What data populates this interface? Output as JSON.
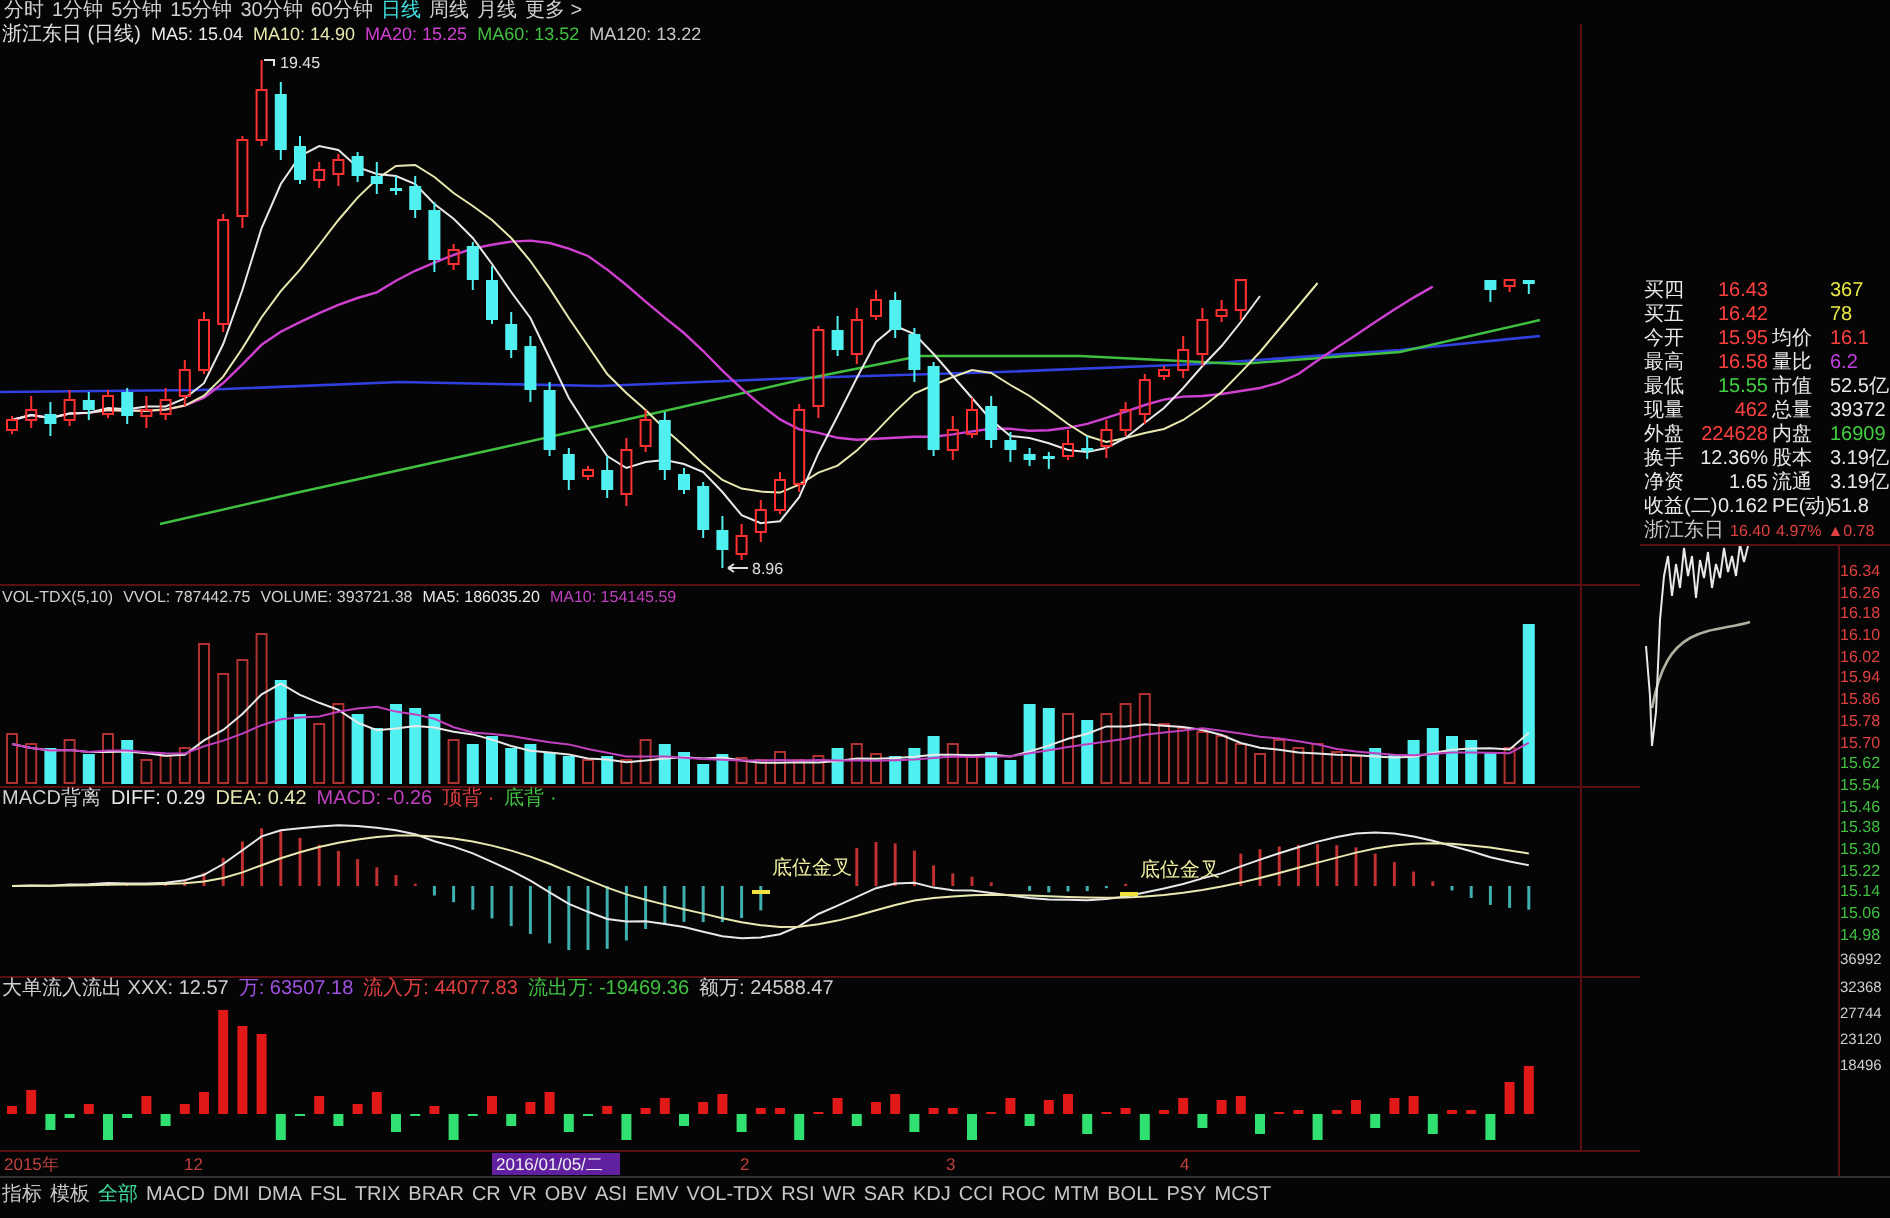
{
  "period_tabs": [
    {
      "label": "分时",
      "selected": false
    },
    {
      "label": "1分钟",
      "selected": false
    },
    {
      "label": "5分钟",
      "selected": false
    },
    {
      "label": "15分钟",
      "selected": false
    },
    {
      "label": "30分钟",
      "selected": false
    },
    {
      "label": "60分钟",
      "selected": false
    },
    {
      "label": "日线",
      "selected": true
    },
    {
      "label": "周线",
      "selected": false
    },
    {
      "label": "月线",
      "selected": false
    },
    {
      "label": "更多 >",
      "selected": false
    }
  ],
  "main_chart": {
    "title": "浙江东日 (日线)",
    "indicators": [
      {
        "text": "MA5: 15.04",
        "color": "#e8e8e8"
      },
      {
        "text": "MA10: 14.90",
        "color": "#e8e8b0"
      },
      {
        "text": "MA20: 15.25",
        "color": "#d040d0"
      },
      {
        "text": "MA60: 13.52",
        "color": "#40c040"
      },
      {
        "text": "MA120: 13.22",
        "color": "#c8c8c8"
      }
    ],
    "high_label": "19.45",
    "low_label": "8.96"
  },
  "volume_panel": {
    "header": [
      {
        "text": "VOL-TDX(5,10)",
        "color": "#d0d0d0"
      },
      {
        "text": "VVOL: 787442.75",
        "color": "#d0d0d0"
      },
      {
        "text": "VOLUME: 393721.38",
        "color": "#d0d0d0"
      },
      {
        "text": "MA5: 186035.20",
        "color": "#e8e8e8"
      },
      {
        "text": "MA10: 154145.59",
        "color": "#c040c0"
      }
    ]
  },
  "macd_panel": {
    "header": [
      {
        "text": "MACD背离",
        "color": "#d0d0d0"
      },
      {
        "text": "DIFF: 0.29",
        "color": "#e8e8e8"
      },
      {
        "text": "DEA: 0.42",
        "color": "#e8e8b0"
      },
      {
        "text": "MACD: -0.26",
        "color": "#c040c0"
      },
      {
        "text": "顶背 ·",
        "color": "#e04040"
      },
      {
        "text": "底背 ·",
        "color": "#40c040"
      }
    ],
    "annotations": [
      "底位金叉",
      "底位金叉"
    ]
  },
  "money_flow_panel": {
    "header": [
      {
        "text": "大单流入流出 XXX: 12.57",
        "color": "#d0d0d0"
      },
      {
        "text": "万: 63507.18",
        "color": "#a050e0"
      },
      {
        "text": "流入万: 44077.83",
        "color": "#e04040"
      },
      {
        "text": "流出万: -19469.36",
        "color": "#40c040"
      },
      {
        "text": "额万: 24588.47",
        "color": "#d0d0d0"
      }
    ]
  },
  "date_axis": [
    {
      "text": "2015年",
      "highlighted": false
    },
    {
      "text": "12",
      "highlighted": false
    },
    {
      "text": "2016/01/05/二",
      "highlighted": true
    },
    {
      "text": "2",
      "highlighted": false
    },
    {
      "text": "3",
      "highlighted": false
    },
    {
      "text": "4",
      "highlighted": false
    }
  ],
  "quote_panel": {
    "rows": [
      {
        "cells": [
          {
            "label": "买四",
            "value": "16.43",
            "color": "#ff4040"
          },
          {
            "value": "367",
            "color": "#e8e840"
          }
        ]
      },
      {
        "cells": [
          {
            "label": "买五",
            "value": "16.42",
            "color": "#ff4040"
          },
          {
            "value": "78",
            "color": "#e8e840"
          }
        ]
      },
      {
        "cells": [
          {
            "label": "今开",
            "value": "15.95",
            "color": "#ff4040"
          },
          {
            "label": "均价",
            "value": "16.1",
            "color": "#ff4040"
          }
        ]
      },
      {
        "cells": [
          {
            "label": "最高",
            "value": "16.58",
            "color": "#ff4040"
          },
          {
            "label": "量比",
            "value": "6.2",
            "color": "#c040e0"
          }
        ]
      },
      {
        "cells": [
          {
            "label": "最低",
            "value": "15.55",
            "color": "#40d040"
          },
          {
            "label": "市值",
            "value": "52.5亿",
            "color": "#e8e8e8"
          }
        ]
      },
      {
        "cells": [
          {
            "label": "现量",
            "value": "462",
            "color": "#ff4040"
          },
          {
            "label": "总量",
            "value": "39372",
            "color": "#e8e8e8"
          }
        ]
      },
      {
        "cells": [
          {
            "label": "外盘",
            "value": "224628",
            "color": "#ff4040"
          },
          {
            "label": "内盘",
            "value": "16909",
            "color": "#40d040"
          }
        ]
      },
      {
        "cells": [
          {
            "label": "换手",
            "value": "12.36%",
            "color": "#e8e8e8"
          },
          {
            "label": "股本",
            "value": "3.19亿",
            "color": "#e8e8e8"
          }
        ]
      },
      {
        "cells": [
          {
            "label": "净资",
            "value": "1.65",
            "color": "#e8e8e8"
          },
          {
            "label": "流通",
            "value": "3.19亿",
            "color": "#e8e8e8"
          }
        ]
      },
      {
        "cells": [
          {
            "label": "收益(二)",
            "value": "0.162",
            "color": "#e8e8e8"
          },
          {
            "label": "PE(动)",
            "value": "51.8",
            "color": "#e8e8e8"
          }
        ]
      }
    ],
    "summary": {
      "name": "浙江东日",
      "price": "16.40",
      "change_pct": "4.97%",
      "change": "▲0.78"
    }
  },
  "intraday_axis": {
    "price_labels": [
      {
        "text": "16.34",
        "color": "#e04040"
      },
      {
        "text": "16.26",
        "color": "#e04040"
      },
      {
        "text": "16.18",
        "color": "#e04040"
      },
      {
        "text": "16.10",
        "color": "#e04040"
      },
      {
        "text": "16.02",
        "color": "#e04040"
      },
      {
        "text": "15.94",
        "color": "#e04040"
      },
      {
        "text": "15.86",
        "color": "#e04040"
      },
      {
        "text": "15.78",
        "color": "#e04040"
      },
      {
        "text": "15.70",
        "color": "#e04040"
      },
      {
        "text": "15.62",
        "color": "#40c040"
      },
      {
        "text": "15.54",
        "color": "#40c040"
      },
      {
        "text": "15.46",
        "color": "#40c040"
      },
      {
        "text": "15.38",
        "color": "#40c040"
      },
      {
        "text": "15.30",
        "color": "#40c040"
      },
      {
        "text": "15.22",
        "color": "#40c040"
      },
      {
        "text": "15.14",
        "color": "#40c040"
      },
      {
        "text": "15.06",
        "color": "#40c040"
      },
      {
        "text": "14.98",
        "color": "#40c040"
      }
    ],
    "volume_labels": [
      "36992",
      "32368",
      "27744",
      "23120",
      "18496"
    ]
  },
  "indicator_tabs": [
    {
      "label": "指标",
      "selected": false
    },
    {
      "label": "模板",
      "selected": false
    },
    {
      "label": "全部",
      "selected": true
    },
    {
      "label": "MACD",
      "selected": false
    },
    {
      "label": "DMI",
      "selected": false
    },
    {
      "label": "DMA",
      "selected": false
    },
    {
      "label": "FSL",
      "selected": false
    },
    {
      "label": "TRIX",
      "selected": false
    },
    {
      "label": "BRAR",
      "selected": false
    },
    {
      "label": "CR",
      "selected": false
    },
    {
      "label": "VR",
      "selected": false
    },
    {
      "label": "OBV",
      "selected": false
    },
    {
      "label": "ASI",
      "selected": false
    },
    {
      "label": "EMV",
      "selected": false
    },
    {
      "label": "VOL-TDX",
      "selected": false
    },
    {
      "label": "RSI",
      "selected": false
    },
    {
      "label": "WR",
      "selected": false
    },
    {
      "label": "SAR",
      "selected": false
    },
    {
      "label": "KDJ",
      "selected": false
    },
    {
      "label": "CCI",
      "selected": false
    },
    {
      "label": "ROC",
      "selected": false
    },
    {
      "label": "MTM",
      "selected": false
    },
    {
      "label": "BOLL",
      "selected": false
    },
    {
      "label": "PSY",
      "selected": false
    },
    {
      "label": "MCST",
      "selected": false
    }
  ]
}
